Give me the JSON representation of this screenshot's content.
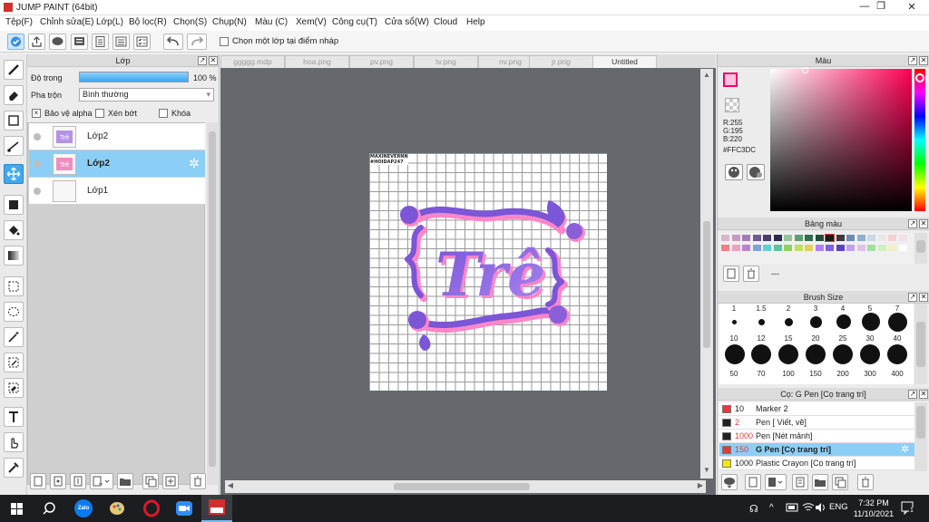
{
  "window": {
    "title": "JUMP PAINT (64bit)"
  },
  "menu": [
    "Tệp(F)",
    "Chỉnh sửa(E)",
    "Lớp(L)",
    "Bộ lọc(R)",
    "Chọn(S)",
    "Chụp(N)",
    "Màu (C)",
    "Xem(V)",
    "Công cụ(T)",
    "Cửa sổ(W)",
    "Cloud",
    "Help"
  ],
  "toolbar": {
    "draft_checkbox_label": "Chọn một lớp tại điểm nháp"
  },
  "layer_panel": {
    "title": "Lớp",
    "opacity_label": "Độ trong",
    "opacity_value": "100 %",
    "opacity_fraction": 1.0,
    "blend_label": "Pha trộn",
    "blend_value": "Bình thường",
    "protect_alpha": "Bảo vệ alpha",
    "clipping": "Xén bớt",
    "lock": "Khóa",
    "layers": [
      {
        "name": "Lớp2",
        "selected": false
      },
      {
        "name": "Lớp2",
        "selected": true
      },
      {
        "name": "Lớp1",
        "selected": false
      }
    ]
  },
  "tabs": [
    "ggggg.mdp",
    "hoa.png",
    "pv.png",
    "tv.png",
    "nv.png",
    "jr.png",
    "Untitled"
  ],
  "canvas": {
    "watermark_line1": "MAXINEVERNN",
    "watermark_line2": "#HOIDAP247"
  },
  "color_panel": {
    "title": "Màu",
    "r": "R:255",
    "g": "G:195",
    "b": "B:220",
    "hex": "#FFC3DC",
    "current_color": "#FFC3DC"
  },
  "palette_panel": {
    "title": "Bảng màu",
    "empty_label": "---"
  },
  "brush_size_panel": {
    "title": "Brush Size",
    "row1": [
      "1",
      "1.5",
      "2",
      "3",
      "4",
      "5",
      "7"
    ],
    "row2": [
      "10",
      "12",
      "15",
      "20",
      "25",
      "30",
      "40"
    ],
    "row3": [
      "50",
      "70",
      "100",
      "150",
      "200",
      "300",
      "400"
    ]
  },
  "brush_list_panel": {
    "title": "Cọ: G Pen [Cọ trang trí]",
    "brushes": [
      {
        "size": "10",
        "name": "Marker 2",
        "color": "#e53935",
        "size_color": "#222",
        "selected": false
      },
      {
        "size": "2",
        "name": "Pen [ Viết, vẽ]",
        "color": "#222222",
        "size_color": "#e53935",
        "selected": false
      },
      {
        "size": "1000",
        "name": "Pen [Nét mảnh]",
        "color": "#222222",
        "size_color": "#e53935",
        "selected": false
      },
      {
        "size": "150",
        "name": "G Pen [Cọ trang trí]",
        "color": "#e53935",
        "size_color": "#e53935",
        "selected": true
      },
      {
        "size": "1000",
        "name": "Plastic Crayon [Cọ trang trí]",
        "color": "#f4e800",
        "size_color": "#222",
        "selected": false
      }
    ]
  },
  "taskbar": {
    "lang": "ENG",
    "time": "7:32 PM",
    "date": "11/10/2021",
    "zalo_label": "Zalo",
    "notification_count": "1"
  },
  "colors": {
    "accent": "#41a9f0",
    "selection": "#8ccff6",
    "canvas_bg": "#65696e"
  }
}
